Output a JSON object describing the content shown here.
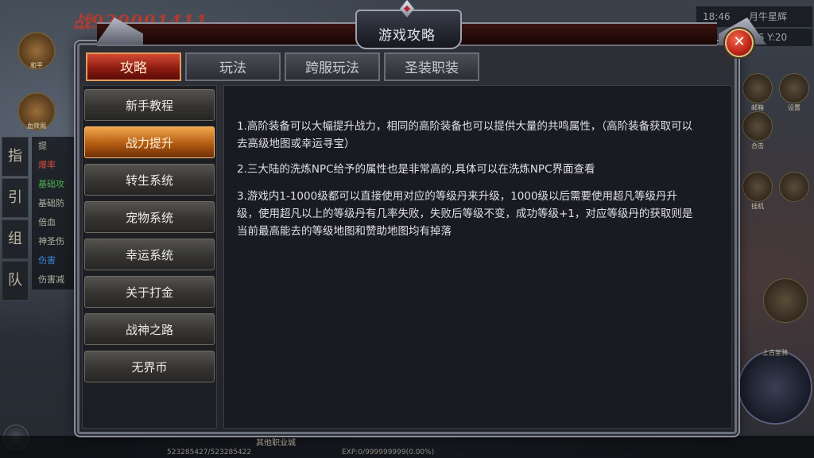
{
  "background": {
    "power_text": "战939091411",
    "avatar_label": "和平",
    "avatar2_label": "血赎阁",
    "side_letters": [
      "指",
      "引",
      "组",
      "队"
    ],
    "side_list": [
      "提",
      "爆率",
      "基础攻",
      "基础防",
      "倍血",
      "神圣伤",
      "伤害",
      "伤害减"
    ],
    "time": "18:46",
    "map_name": "月牛星辉",
    "coords": "76 Y:20",
    "right_buttons": [
      "邮箱",
      "设置",
      "合击",
      "挂机",
      "上古坐骑"
    ],
    "bottom_line1": "其他职业城",
    "bottom_line2": "523285427/523285422",
    "bottom_line3": "EXP:0/999999999(0.00%)"
  },
  "panel": {
    "title": "游戏攻略",
    "close_icon": "close-icon"
  },
  "tabs": [
    {
      "label": "攻略",
      "active": true
    },
    {
      "label": "玩法",
      "active": false
    },
    {
      "label": "跨服玩法",
      "active": false
    },
    {
      "label": "圣装职装",
      "active": false
    }
  ],
  "nav": [
    {
      "label": "新手教程",
      "active": false
    },
    {
      "label": "战力提升",
      "active": true
    },
    {
      "label": "转生系统",
      "active": false
    },
    {
      "label": "宠物系统",
      "active": false
    },
    {
      "label": "幸运系统",
      "active": false
    },
    {
      "label": "关于打金",
      "active": false
    },
    {
      "label": "战神之路",
      "active": false
    },
    {
      "label": "无界币",
      "active": false
    }
  ],
  "content": {
    "paragraphs": [
      "1.高阶装备可以大幅提升战力，相同的高阶装备也可以提供大量的共鸣属性，（高阶装备获取可以去高级地图或幸运寻宝）",
      "2.三大陆的洗炼NPC给予的属性也是非常高的,具体可以在洗炼NPC界面查看",
      "3.游戏内1-1000级都可以直接使用对应的等级丹来升级，1000级以后需要使用超凡等级丹升级，使用超凡以上的等级丹有几率失败，失败后等级不变，成功等级+1，对应等级丹的获取则是当前最高能去的等级地图和赞助地图均有掉落"
    ]
  },
  "colors": {
    "active_tab": "#b4281a",
    "active_nav": "#d27a22",
    "panel_bg": "#1a1b20"
  }
}
